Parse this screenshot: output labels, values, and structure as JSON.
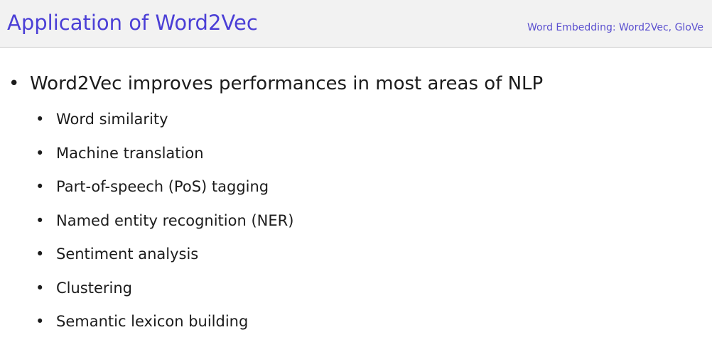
{
  "header": {
    "title": "Application of Word2Vec",
    "subtitle": "Word Embedding: Word2Vec, GloVe"
  },
  "content": {
    "bullet_symbol": "•",
    "main_point": "Word2Vec improves performances in most areas of NLP",
    "sub_points": [
      "Word similarity",
      "Machine translation",
      "Part-of-speech (PoS) tagging",
      "Named entity recognition (NER)",
      "Sentiment analysis",
      "Clustering",
      "Semantic lexicon building"
    ]
  },
  "colors": {
    "title": "#4b3fd6",
    "subtitle": "#5a4fcf",
    "header_background": "#f2f2f2",
    "text": "#1c1c1c"
  }
}
